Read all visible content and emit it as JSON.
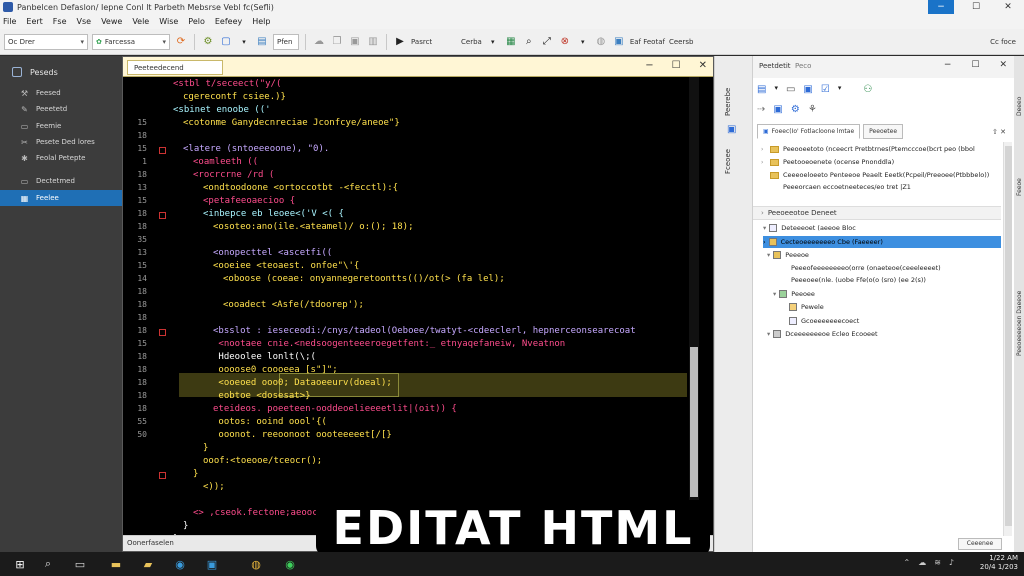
{
  "titlebar": {
    "title": "Panbelcen Defaslon/ Iepne Conl lt Parbeth Mebsrse Vebl fc(Sefli)",
    "buttons": [
      "−",
      "☐",
      "✕"
    ]
  },
  "menubar": [
    "File",
    "Eert",
    "Fse",
    "Vse",
    "Vewe",
    "Vele",
    "Wise",
    "Pelo",
    "Eefeey",
    "Help"
  ],
  "toolbar": {
    "combo1": "Oc Drer",
    "combo2": "Farcessa",
    "combo3": "Pfen",
    "text1": "Pasrct",
    "text2": "Cerba",
    "text3": "Eaf Feotaf",
    "text4": "Ceersb",
    "text5": "Cc foce"
  },
  "sidebar": {
    "header": "Peseds",
    "items": [
      {
        "label": "Feesed",
        "icon": "wrench-icon"
      },
      {
        "label": "Peeetetd",
        "icon": "pencil-icon"
      },
      {
        "label": "Feemie",
        "icon": "page-icon"
      },
      {
        "label": "Pesete Ded lores",
        "icon": "tools-icon"
      },
      {
        "label": "Feolal Petepte",
        "icon": "puzzle-icon"
      },
      {
        "label": "Dectetmed",
        "icon": "page-icon"
      },
      {
        "label": "Feelee",
        "icon": "grid-icon"
      }
    ]
  },
  "editor": {
    "tab": "Peeteedecend",
    "status": "Oonerfaselen",
    "line_numbers": [
      "",
      "",
      "",
      "",
      "",
      "",
      "",
      "18",
      "1",
      "",
      "",
      "",
      "",
      "",
      "",
      "",
      "10",
      "",
      "",
      "",
      "",
      "",
      "",
      "18",
      "18",
      "",
      "",
      "",
      "",
      "",
      "",
      "",
      "50"
    ],
    "gutter": [
      {
        "n": "15"
      },
      {
        "n": "18"
      },
      {
        "n": "15"
      },
      {
        "n": "1"
      },
      {
        "n": "18"
      },
      {
        "n": "13"
      },
      {
        "n": "15"
      },
      {
        "n": "18"
      },
      {
        "n": "18"
      },
      {
        "n": "35"
      },
      {
        "n": "13"
      },
      {
        "n": "15"
      },
      {
        "n": "14"
      },
      {
        "n": "18"
      },
      {
        "n": "18"
      },
      {
        "n": "18"
      },
      {
        "n": "18"
      },
      {
        "n": "15"
      },
      {
        "n": "18"
      },
      {
        "n": "18"
      },
      {
        "n": "18"
      },
      {
        "n": "18"
      },
      {
        "n": "18"
      },
      {
        "n": "55"
      },
      {
        "n": "50"
      }
    ],
    "code_lines": [
      {
        "indent": 1,
        "text": "<stbl t/seceect(\"y/(",
        "color": "#ff4d8d"
      },
      {
        "indent": 2,
        "text": "cgerecontf csiee.)}",
        "color": "#ffe14d"
      },
      {
        "indent": 1,
        "text": "<sbinet enoobe (('",
        "color": "#a9f5ff"
      },
      {
        "indent": 2,
        "text": "<cotonme Ganydecnreciae Jconfcye/aneoe\"}",
        "color": "#ffe14d"
      },
      {
        "indent": 0,
        "text": "",
        "color": "#fff"
      },
      {
        "indent": 2,
        "text": "<latere (sntoeeeoone), \"0).",
        "color": "#c6a9ff"
      },
      {
        "indent": 3,
        "text": "<oamleeth ((",
        "color": "#ff4d8d"
      },
      {
        "indent": 3,
        "text": "<rocrcrne /rd (",
        "color": "#ff4d8d"
      },
      {
        "indent": 4,
        "text": "<ondtoodoone <ortoccotbt -<fecctl):{",
        "color": "#ffe14d"
      },
      {
        "indent": 4,
        "text": "<petafeeoaecioo {",
        "color": "#ff4d8d"
      },
      {
        "indent": 4,
        "text": "<inbepce eb leoee<('V <( {",
        "color": "#a9f5ff"
      },
      {
        "indent": 5,
        "text": "<osoteo:ano(ile.<ateamel)/ o:(); 18);",
        "color": "#ffe14d"
      },
      {
        "indent": 0,
        "text": "",
        "color": "#fff"
      },
      {
        "indent": 5,
        "text": "<onopecttel <ascetfi((",
        "color": "#c6a9ff"
      },
      {
        "indent": 5,
        "text": "<ooeiee <teoaest. onfoe\"\\'{",
        "color": "#ffe14d"
      },
      {
        "indent": 6,
        "text": "<oboose (coeae: onyannegeretoontts(()/ot(> (fa lel);",
        "color": "#ffe14d"
      },
      {
        "indent": 0,
        "text": "",
        "color": "#fff"
      },
      {
        "indent": 6,
        "text": "<ooadect <Asfe(/tdoorep');",
        "color": "#ffe14d"
      },
      {
        "indent": 0,
        "text": "",
        "color": "#fff"
      },
      {
        "indent": 5,
        "text": "<bsslot : ieseceodi:/cnys/tadeol(Oeboee/twatyt-<cdeeclerl, hepnerceonsearecoat",
        "color": "#c6a9ff"
      },
      {
        "indent": 5,
        "text": " <nootaee cnie.<nedsoogenteeeroegetfent:_ etnyaqefaneiw, Nveatnon",
        "color": "#ff4d8d"
      },
      {
        "indent": 5,
        "text": " Hdeoolee lonlt(\\;(",
        "color": "#ffffff"
      },
      {
        "indent": 5,
        "text": " oooose0 coooeea [s\"]\";",
        "color": "#ffe14d"
      },
      {
        "indent": 5,
        "text": " <ooeoed ooo0; Dataoeeurv(doeal);",
        "color": "#ffe14d"
      },
      {
        "indent": 5,
        "text": " eobtoe <dosesat>}",
        "color": "#ffe14d"
      },
      {
        "indent": 5,
        "text": "eteideos. poeeteen-ooddeoelieeeetlit|(oit)) {",
        "color": "#ff4d8d"
      },
      {
        "indent": 5,
        "text": " ootos: ooind oool'{(",
        "color": "#ffe14d"
      },
      {
        "indent": 5,
        "text": " ooonot. reeoonoot oooteeeeet[/[}",
        "color": "#ffe14d"
      },
      {
        "indent": 4,
        "text": "}",
        "color": "#ffe14d"
      },
      {
        "indent": 4,
        "text": "ooof:<toeooe/tceocr();",
        "color": "#ffe14d"
      },
      {
        "indent": 3,
        "text": "}",
        "color": "#ffe14d"
      },
      {
        "indent": 4,
        "text": "<));",
        "color": "#ffe14d"
      },
      {
        "indent": 0,
        "text": "",
        "color": "#fff"
      },
      {
        "indent": 3,
        "text": "<> ,cseok.fectone;aeoocres\"://}",
        "color": "#ff4d8d"
      },
      {
        "indent": 2,
        "text": "}",
        "color": "#ffffff"
      },
      {
        "indent": 1,
        "text": "}",
        "color": "#ffffff"
      }
    ]
  },
  "rightstrip": [
    "Peerebe",
    "Fceoee"
  ],
  "rightpanel": {
    "title": "Peetdetit",
    "subtitle": "Peco",
    "tabs": [
      "Foeec(Io' Fotlacloone lmtae",
      "Peeoetee"
    ],
    "tab_tools": [
      "⇧",
      "✕"
    ],
    "files": [
      "Peeooeetoto (nceecrt Pretbtrnes(Ptemcccoe(bcrt peo (bbol",
      "Peetooeoenete (ocense Pnonddla)",
      "Ceeeoeloeeto Penteeoe Peaelt Eeetk(Pcpeil/Preeoee(Ptbbbelo))",
      "Peeeorcaen eccoetneeteces/eo tret |Z1"
    ],
    "section": "Peeoeeotoe Deneet",
    "tree": [
      {
        "label": "Deteeeoet (aeeoe Bloc",
        "level": 0,
        "sel": false
      },
      {
        "label": "Cecteoeeeeeeeo Cbe (Faeeeer)",
        "level": 0,
        "sel": true
      },
      {
        "label": "Peeeoe",
        "level": 1,
        "sel": false
      },
      {
        "label": "Peeeofeeeeeeeeo(orre (onaeteoe(ceeeleeeet)",
        "level": 2,
        "sel": false
      },
      {
        "label": "Peeeoee(nle. (uobe Ffe(o(o (sro) (ee 2(s))",
        "level": 2,
        "sel": false
      },
      {
        "label": "Peeoee",
        "level": 1,
        "sel": false
      },
      {
        "label": "Pewele",
        "level": 2,
        "sel": false
      },
      {
        "label": "Gcoeeeeeeecoect",
        "level": 2,
        "sel": false
      },
      {
        "label": "Dceeeeeeeoe Ecleo Ecooeet",
        "level": 0,
        "sel": false
      }
    ],
    "status": "Ceeenee"
  },
  "farright": [
    "Peeoeeeeoen Daeeoe",
    "Deeeo",
    "Feeoe"
  ],
  "banner": "EDITAT HTML",
  "taskbar": {
    "time": "1/22 AM",
    "date": "20/4 1/203",
    "apps": [
      "start-icon",
      "search-icon",
      "taskview-icon",
      "files-icon",
      "explorer-icon",
      "edge-icon",
      "store-icon",
      "chrome-icon",
      "spotify-icon"
    ]
  }
}
